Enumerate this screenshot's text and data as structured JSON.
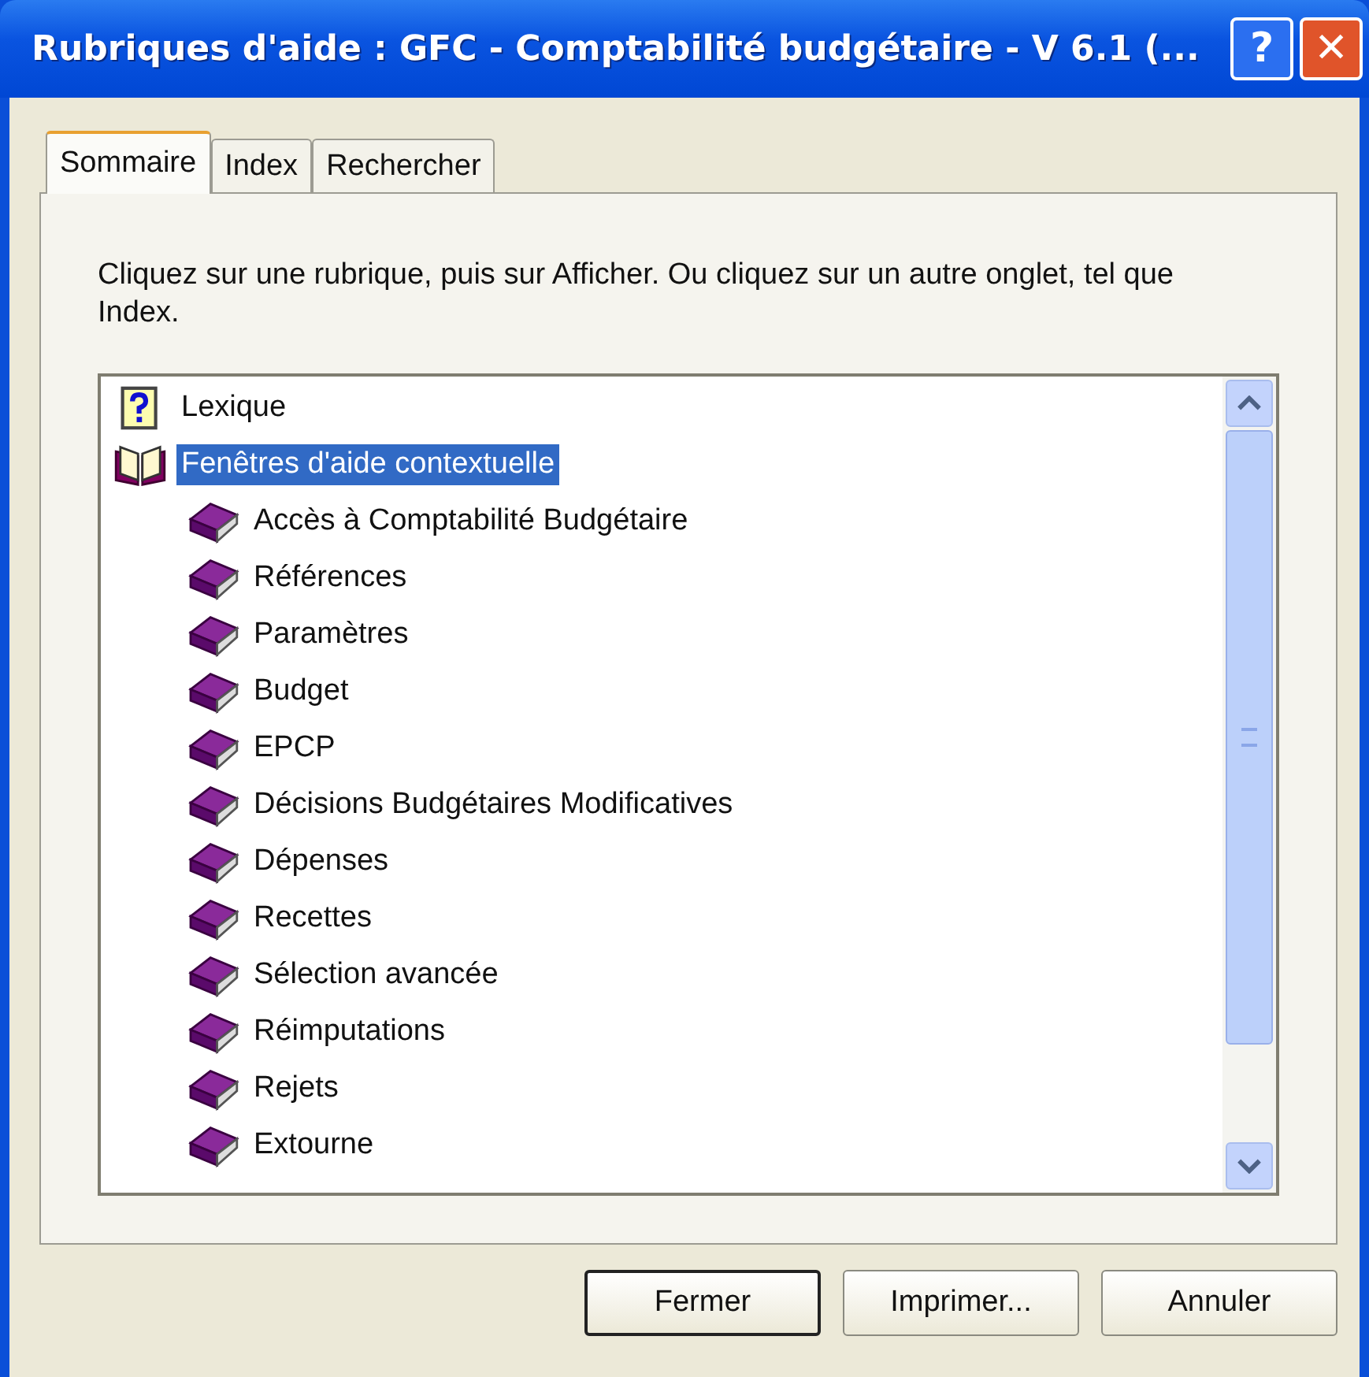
{
  "window": {
    "title": "Rubriques d'aide : GFC - Comptabilité budgétaire - V 6.1 (...",
    "help_button": "?",
    "close_button": "✕"
  },
  "tabs": [
    {
      "label": "Sommaire",
      "selected": true
    },
    {
      "label": "Index",
      "selected": false
    },
    {
      "label": "Rechercher",
      "selected": false
    }
  ],
  "instructions": "Cliquez sur une rubrique, puis sur Afficher. Ou cliquez sur un autre onglet, tel que Index.",
  "tree": [
    {
      "label": "Lexique",
      "kind": "topic",
      "selected": false
    },
    {
      "label": "Fenêtres d'aide contextuelle",
      "kind": "book",
      "expanded": true,
      "selected": true,
      "children": [
        {
          "label": "Accès à Comptabilité Budgétaire",
          "kind": "book",
          "expanded": false,
          "selected": false
        },
        {
          "label": "Références",
          "kind": "book",
          "expanded": false,
          "selected": false
        },
        {
          "label": "Paramètres",
          "kind": "book",
          "expanded": false,
          "selected": false
        },
        {
          "label": "Budget",
          "kind": "book",
          "expanded": false,
          "selected": false
        },
        {
          "label": "EPCP",
          "kind": "book",
          "expanded": false,
          "selected": false
        },
        {
          "label": "Décisions Budgétaires Modificatives",
          "kind": "book",
          "expanded": false,
          "selected": false
        },
        {
          "label": "Dépenses",
          "kind": "book",
          "expanded": false,
          "selected": false
        },
        {
          "label": "Recettes",
          "kind": "book",
          "expanded": false,
          "selected": false
        },
        {
          "label": "Sélection avancée",
          "kind": "book",
          "expanded": false,
          "selected": false
        },
        {
          "label": "Réimputations",
          "kind": "book",
          "expanded": false,
          "selected": false
        },
        {
          "label": "Rejets",
          "kind": "book",
          "expanded": false,
          "selected": false
        },
        {
          "label": "Extourne",
          "kind": "book",
          "expanded": false,
          "selected": false
        }
      ]
    }
  ],
  "buttons": [
    {
      "label": "Fermer",
      "default": true
    },
    {
      "label": "Imprimer...",
      "default": false
    },
    {
      "label": "Annuler",
      "default": false
    }
  ]
}
